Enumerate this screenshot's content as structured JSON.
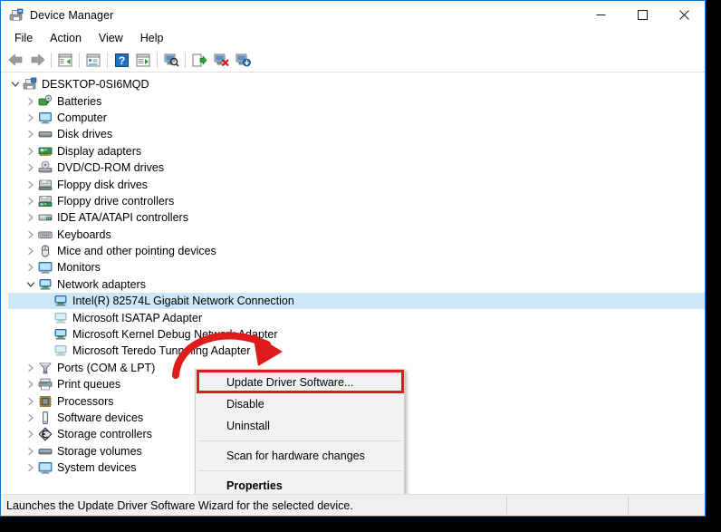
{
  "window": {
    "title": "Device Manager",
    "title_icon": "device-manager-icon",
    "controls": {
      "minimize": "—",
      "maximize": "□",
      "close": "✕"
    }
  },
  "menubar": {
    "items": [
      {
        "label": "File"
      },
      {
        "label": "Action"
      },
      {
        "label": "View"
      },
      {
        "label": "Help"
      }
    ]
  },
  "toolbar": {
    "buttons": [
      {
        "name": "back-button",
        "icon": "back-arrow-icon"
      },
      {
        "name": "forward-button",
        "icon": "forward-arrow-icon"
      },
      {
        "name": "separator-1",
        "icon": "separator"
      },
      {
        "name": "show-hide-console-tree-button",
        "icon": "console-tree-icon"
      },
      {
        "name": "separator-2",
        "icon": "separator"
      },
      {
        "name": "properties-button",
        "icon": "properties-window-icon"
      },
      {
        "name": "separator-3",
        "icon": "separator"
      },
      {
        "name": "help-button",
        "icon": "help-question-icon"
      },
      {
        "name": "action-button",
        "icon": "action-play-icon"
      },
      {
        "name": "separator-4",
        "icon": "separator"
      },
      {
        "name": "scan-for-hardware-changes-button",
        "icon": "scan-hardware-icon"
      },
      {
        "name": "separator-5",
        "icon": "separator"
      },
      {
        "name": "update-driver-software-button",
        "icon": "update-driver-icon"
      },
      {
        "name": "uninstall-device-button",
        "icon": "uninstall-device-icon"
      },
      {
        "name": "disable-device-button",
        "icon": "disable-device-icon"
      }
    ]
  },
  "tree": {
    "nodes": [
      {
        "label": "DESKTOP-0SI6MQD",
        "depth": 0,
        "state": "expanded",
        "icon": "computer-root-icon",
        "selected": false
      },
      {
        "label": "Batteries",
        "depth": 1,
        "state": "collapsed",
        "icon": "batteries-icon",
        "selected": false
      },
      {
        "label": "Computer",
        "depth": 1,
        "state": "collapsed",
        "icon": "computer-icon",
        "selected": false
      },
      {
        "label": "Disk drives",
        "depth": 1,
        "state": "collapsed",
        "icon": "disk-drive-icon",
        "selected": false
      },
      {
        "label": "Display adapters",
        "depth": 1,
        "state": "collapsed",
        "icon": "display-adapter-icon",
        "selected": false
      },
      {
        "label": "DVD/CD-ROM drives",
        "depth": 1,
        "state": "collapsed",
        "icon": "dvd-drive-icon",
        "selected": false
      },
      {
        "label": "Floppy disk drives",
        "depth": 1,
        "state": "collapsed",
        "icon": "floppy-disk-icon",
        "selected": false
      },
      {
        "label": "Floppy drive controllers",
        "depth": 1,
        "state": "collapsed",
        "icon": "floppy-controller-icon",
        "selected": false
      },
      {
        "label": "IDE ATA/ATAPI controllers",
        "depth": 1,
        "state": "collapsed",
        "icon": "ide-controller-icon",
        "selected": false
      },
      {
        "label": "Keyboards",
        "depth": 1,
        "state": "collapsed",
        "icon": "keyboard-icon",
        "selected": false
      },
      {
        "label": "Mice and other pointing devices",
        "depth": 1,
        "state": "collapsed",
        "icon": "mouse-icon",
        "selected": false
      },
      {
        "label": "Monitors",
        "depth": 1,
        "state": "collapsed",
        "icon": "monitor-icon",
        "selected": false
      },
      {
        "label": "Network adapters",
        "depth": 1,
        "state": "expanded",
        "icon": "network-adapter-icon",
        "selected": false
      },
      {
        "label": "Intel(R) 82574L Gigabit Network Connection",
        "depth": 2,
        "state": "leaf",
        "icon": "network-adapter-icon",
        "selected": true
      },
      {
        "label": "Microsoft ISATAP Adapter",
        "depth": 2,
        "state": "leaf",
        "icon": "network-adapter-faded-icon",
        "selected": false
      },
      {
        "label": "Microsoft Kernel Debug Network Adapter",
        "depth": 2,
        "state": "leaf",
        "icon": "network-adapter-icon",
        "selected": false
      },
      {
        "label": "Microsoft Teredo Tunneling Adapter",
        "depth": 2,
        "state": "leaf",
        "icon": "network-adapter-faded-icon",
        "selected": false
      },
      {
        "label": "Ports (COM & LPT)",
        "depth": 1,
        "state": "collapsed",
        "icon": "ports-icon",
        "selected": false
      },
      {
        "label": "Print queues",
        "depth": 1,
        "state": "collapsed",
        "icon": "printer-icon",
        "selected": false
      },
      {
        "label": "Processors",
        "depth": 1,
        "state": "collapsed",
        "icon": "processor-icon",
        "selected": false
      },
      {
        "label": "Software devices",
        "depth": 1,
        "state": "collapsed",
        "icon": "software-device-icon",
        "selected": false
      },
      {
        "label": "Storage controllers",
        "depth": 1,
        "state": "collapsed",
        "icon": "storage-controller-icon",
        "selected": false
      },
      {
        "label": "Storage volumes",
        "depth": 1,
        "state": "collapsed",
        "icon": "storage-volume-icon",
        "selected": false
      },
      {
        "label": "System devices",
        "depth": 1,
        "state": "collapsed",
        "icon": "system-device-icon",
        "selected": false
      }
    ]
  },
  "context_menu": {
    "items": [
      {
        "label": "Update Driver Software...",
        "bold": false,
        "highlighted": true,
        "type": "item"
      },
      {
        "label": "Disable",
        "bold": false,
        "highlighted": false,
        "type": "item"
      },
      {
        "label": "Uninstall",
        "bold": false,
        "highlighted": false,
        "type": "item"
      },
      {
        "type": "separator"
      },
      {
        "label": "Scan for hardware changes",
        "bold": false,
        "highlighted": false,
        "type": "item"
      },
      {
        "type": "separator"
      },
      {
        "label": "Properties",
        "bold": true,
        "highlighted": false,
        "type": "item"
      }
    ]
  },
  "statusbar": {
    "text": "Launches the Update Driver Software Wizard for the selected device."
  },
  "annotations": {
    "arrow_color": "#e01b1b",
    "highlight_box_color": "#e01b1b"
  },
  "colors": {
    "window_border": "#0078d7",
    "selection": "#cce8f7",
    "menu_background": "#f2f2f2",
    "status_background": "#f0f0f0",
    "page_background": "#000000"
  }
}
